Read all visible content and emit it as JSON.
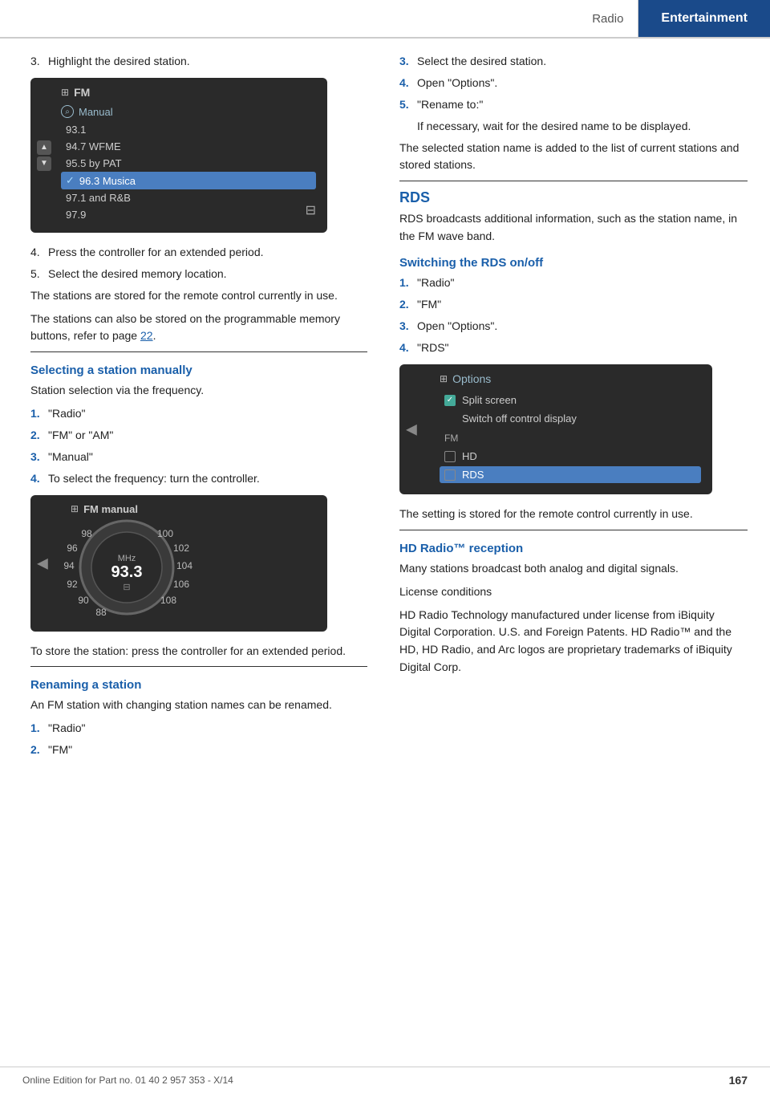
{
  "header": {
    "radio_label": "Radio",
    "entertainment_label": "Entertainment"
  },
  "left_col": {
    "step3": "Highlight the desired station.",
    "step4": "Press the controller for an extended period.",
    "step5": "Select the desired memory location.",
    "para1": "The stations are stored for the remote control currently in use.",
    "para2": "The stations can also be stored on the programmable memory buttons, refer to page 22.",
    "section_selecting": "Selecting a station manually",
    "selecting_intro": "Station selection via the frequency.",
    "sel_step1": "\"Radio\"",
    "sel_step2": "\"FM\" or \"AM\"",
    "sel_step3": "\"Manual\"",
    "sel_step4": "To select the frequency: turn the controller.",
    "store_para": "To store the station: press the controller for an extended period.",
    "section_renaming": "Renaming a station",
    "renaming_intro": "An FM station with changing station names can be renamed.",
    "ren_step1": "\"Radio\"",
    "ren_step2": "\"FM\"",
    "fm_screen": {
      "header": "FM",
      "manual_label": "Manual",
      "items": [
        "93.1",
        "94.7 WFME",
        "95.5 by PAT",
        "96.3 Musica",
        "97.1 and R&B",
        "97.9"
      ],
      "selected_index": 3,
      "selected_check": "✓"
    },
    "fm_manual_screen": {
      "header": "FM manual",
      "center_mhz": "MHz",
      "center_freq": "93.3",
      "freq_labels_left": [
        "98",
        "96",
        "94",
        "92",
        "90",
        "88"
      ],
      "freq_labels_right": [
        "100",
        "102",
        "104",
        "106",
        "108"
      ]
    }
  },
  "right_col": {
    "ren_step3": "Select the desired station.",
    "ren_step4": "Open \"Options\".",
    "ren_step5": "\"Rename to:\"",
    "ren_para1": "If necessary, wait for the desired name to be displayed.",
    "ren_para2": "The selected station name is added to the list of current stations and stored stations.",
    "section_rds": "RDS",
    "rds_para": "RDS broadcasts additional information, such as the station name, in the FM wave band.",
    "section_switching": "Switching the RDS on/off",
    "sw_step1": "\"Radio\"",
    "sw_step2": "\"FM\"",
    "sw_step3": "Open \"Options\".",
    "sw_step4": "\"RDS\"",
    "options_screen": {
      "header": "Options",
      "items": [
        {
          "label": "Split screen",
          "type": "checkbox",
          "checked": true
        },
        {
          "label": "Switch off control display",
          "type": "text"
        },
        {
          "label": "FM",
          "type": "section"
        },
        {
          "label": "HD",
          "type": "checkbox",
          "checked": false
        },
        {
          "label": "RDS",
          "type": "checkbox_selected",
          "checked": false
        }
      ]
    },
    "setting_stored": "The setting is stored for the remote control currently in use.",
    "section_hd": "HD Radio™ reception",
    "hd_para1": "Many stations broadcast both analog and digital signals.",
    "hd_para2": "License conditions",
    "hd_para3": "HD Radio Technology manufactured under license from iBiquity Digital Corporation. U.S. and Foreign Patents. HD Radio™ and the HD, HD Radio, and Arc logos are proprietary trademarks of iBiquity Digital Corp."
  },
  "footer": {
    "online_text": "Online Edition for Part no. 01 40 2 957 353 - X/14",
    "page_number": "167"
  }
}
